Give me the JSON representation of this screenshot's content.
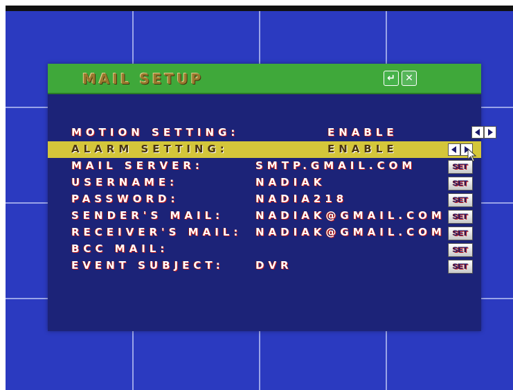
{
  "window": {
    "title": "MAIL SETUP",
    "enter_icon": "enter-icon",
    "close_icon": "close-icon"
  },
  "rows": [
    {
      "label": "MOTION SETTING:",
      "value": "ENABLE",
      "control": "arrows"
    },
    {
      "label": "ALARM SETTING:",
      "value": "ENABLE",
      "control": "arrows",
      "selected": true
    },
    {
      "label": "MAIL SERVER:",
      "value": "SMTP.GMAIL.COM",
      "control": "SET"
    },
    {
      "label": "USERNAME:",
      "value": "NADIAK",
      "control": "SET"
    },
    {
      "label": "PASSWORD:",
      "value": "NADIA218",
      "control": "SET"
    },
    {
      "label": "SENDER'S MAIL:",
      "value": "NADIAK@GMAIL.COM",
      "control": "SET"
    },
    {
      "label": "RECEIVER'S MAIL:",
      "value": "NADIAK@GMAIL.COM",
      "control": "SET"
    },
    {
      "label": "BCC MAIL:",
      "value": "",
      "control": "SET"
    },
    {
      "label": "EVENT SUBJECT:",
      "value": "DVR",
      "control": "SET"
    }
  ],
  "colors": {
    "screen_bg": "#2b3ac0",
    "panel_bg": "#1c2378",
    "titlebar": "#3fa83a",
    "selected_row": "#d4c63a"
  }
}
